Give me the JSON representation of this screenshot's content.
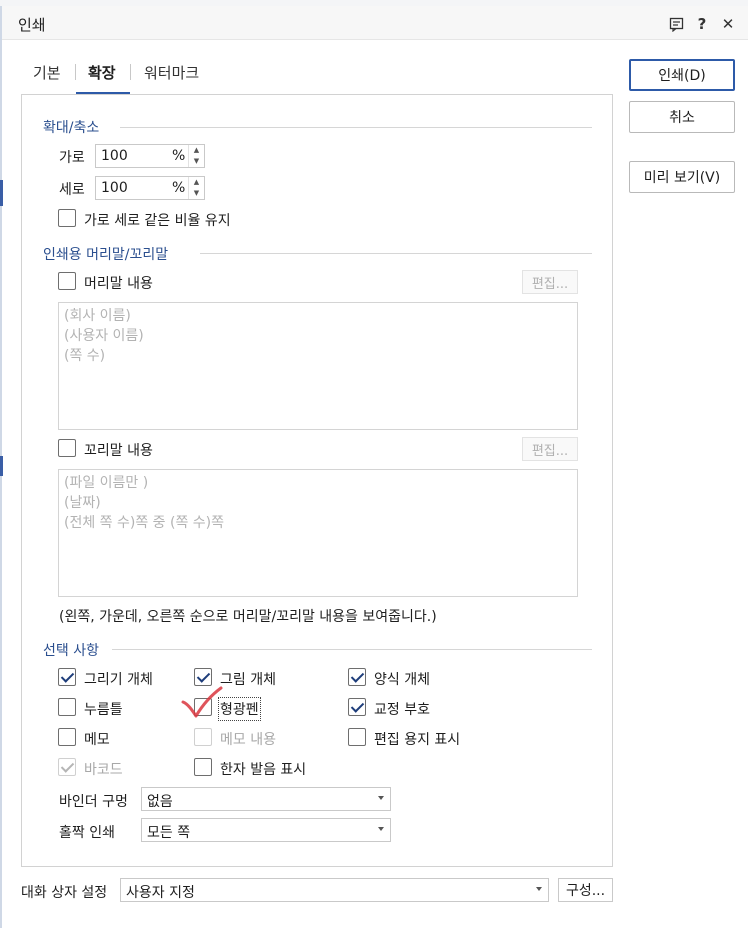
{
  "window": {
    "title": "인쇄"
  },
  "titlebar": {
    "help": "?",
    "close": "✕"
  },
  "tabs": [
    {
      "label": "기본",
      "active": false
    },
    {
      "label": "확장",
      "active": true
    },
    {
      "label": "워터마크",
      "active": false
    }
  ],
  "buttons": {
    "print": "인쇄(D)",
    "cancel": "취소",
    "preview": "미리 보기(V)"
  },
  "zoom": {
    "title": "확대/축소",
    "width_label": "가로",
    "width_value": "100",
    "height_label": "세로",
    "height_value": "100",
    "unit": "%",
    "keep_ratio_label": "가로 세로 같은 비율 유지",
    "keep_ratio_checked": false
  },
  "header_footer": {
    "title": "인쇄용 머리말/꼬리말",
    "header_label": "머리말 내용",
    "header_checked": false,
    "footer_label": "꼬리말 내용",
    "footer_checked": false,
    "edit_label": "편집...",
    "header_lines": [
      "(회사 이름)",
      "(사용자 이름)",
      "(쪽 수)"
    ],
    "footer_lines": [
      "(파일 이름만 )",
      "(날짜)",
      "(전체 쪽 수)쪽 중 (쪽 수)쪽"
    ],
    "note": "(왼쪽, 가운데, 오른쪽 순으로 머리말/꼬리말 내용을 보여줍니다.)"
  },
  "options": {
    "title": "선택 사항",
    "items": [
      {
        "label": "그리기 개체",
        "checked": true,
        "disabled": false
      },
      {
        "label": "그림 개체",
        "checked": true,
        "disabled": false
      },
      {
        "label": "양식 개체",
        "checked": true,
        "disabled": false
      },
      {
        "label": "누름틀",
        "checked": false,
        "disabled": false
      },
      {
        "label": "형광펜",
        "checked": false,
        "disabled": false
      },
      {
        "label": "교정 부호",
        "checked": true,
        "disabled": false
      },
      {
        "label": "메모",
        "checked": false,
        "disabled": false
      },
      {
        "label": "메모 내용",
        "checked": false,
        "disabled": true
      },
      {
        "label": "편집 용지 표시",
        "checked": false,
        "disabled": false
      },
      {
        "label": "바코드",
        "checked": true,
        "disabled": true
      },
      {
        "label": "한자 발음 표시",
        "checked": false,
        "disabled": false
      }
    ],
    "binder_label": "바인더 구멍",
    "binder_value": "없음",
    "oddeven_label": "홀짝 인쇄",
    "oddeven_value": "모든 쪽"
  },
  "footer": {
    "dialog_settings_label": "대화 상자 설정",
    "dialog_settings_value": "사용자 지정",
    "configure_label": "구성..."
  },
  "colors": {
    "accent": "#2d5aa8",
    "section_title": "#2b4f8f",
    "annotation_check": "#d9363e"
  }
}
